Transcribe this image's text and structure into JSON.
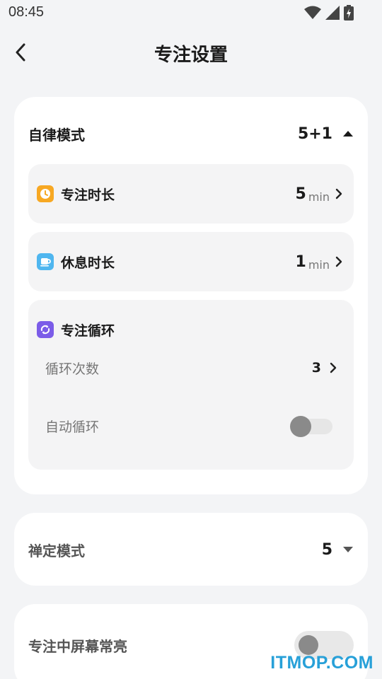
{
  "status_bar": {
    "time": "08:45"
  },
  "header": {
    "title": "专注设置"
  },
  "discipline_mode": {
    "label": "自律模式",
    "value": "5+1",
    "focus_duration": {
      "label": "专注时长",
      "value": "5",
      "unit": "min",
      "icon": "clock-icon",
      "icon_color": "#f7a823"
    },
    "rest_duration": {
      "label": "休息时长",
      "value": "1",
      "unit": "min",
      "icon": "cup-icon",
      "icon_color": "#4fb6ef"
    },
    "focus_cycle": {
      "label": "专注循环",
      "icon": "cycle-icon",
      "icon_color": "#7b5ce8",
      "cycle_count": {
        "label": "循环次数",
        "value": "3"
      },
      "auto_cycle": {
        "label": "自动循环",
        "enabled": false
      }
    }
  },
  "zen_mode": {
    "label": "禅定模式",
    "value": "5"
  },
  "screen_on": {
    "label": "专注中屏幕常亮",
    "enabled": false
  },
  "watermark": "ITMOP.COM"
}
